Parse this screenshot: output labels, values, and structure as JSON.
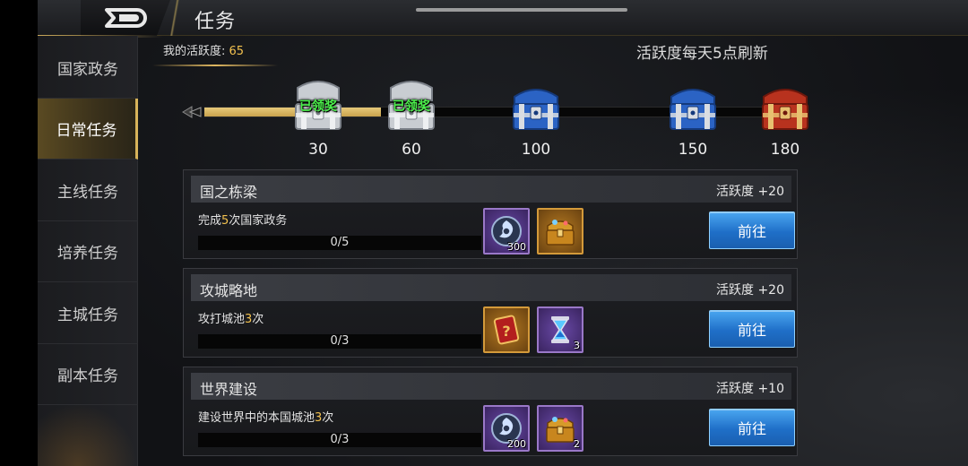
{
  "header": {
    "title": "任务",
    "back_icon": "back-arrow-icon"
  },
  "sidebar": {
    "items": [
      {
        "label": "国家政务",
        "active": false
      },
      {
        "label": "日常任务",
        "active": true
      },
      {
        "label": "主线任务",
        "active": false
      },
      {
        "label": "培养任务",
        "active": false
      },
      {
        "label": "主城任务",
        "active": false
      },
      {
        "label": "副本任务",
        "active": false
      }
    ]
  },
  "activity": {
    "label": "我的活跃度: ",
    "value": "65",
    "refresh_note": "活跃度每天5点刷新",
    "progress_value": 65,
    "progress_max": 180
  },
  "chests": [
    {
      "threshold": "30",
      "type": "silver",
      "claimed": true,
      "claimed_label": "已领奖"
    },
    {
      "threshold": "60",
      "type": "silver",
      "claimed": true,
      "claimed_label": "已领奖"
    },
    {
      "threshold": "100",
      "type": "blue",
      "claimed": false,
      "claimed_label": ""
    },
    {
      "threshold": "150",
      "type": "blue",
      "claimed": false,
      "claimed_label": ""
    },
    {
      "threshold": "180",
      "type": "red",
      "claimed": false,
      "claimed_label": ""
    }
  ],
  "tasks": [
    {
      "title": "国之栋梁",
      "points": "活跃度 +20",
      "desc_pre": "完成",
      "desc_num": "5",
      "desc_post": "次国家政务",
      "progress": "0/5",
      "button": "前往",
      "rewards": [
        {
          "icon": "silver-coin-icon",
          "style": "purple",
          "count": "300"
        },
        {
          "icon": "treasure-chest-icon",
          "style": "orange",
          "count": ""
        }
      ]
    },
    {
      "title": "攻城略地",
      "points": "活跃度 +20",
      "desc_pre": "攻打城池",
      "desc_num": "3",
      "desc_post": "次",
      "progress": "0/3",
      "button": "前往",
      "rewards": [
        {
          "icon": "mystery-card-icon",
          "style": "orange",
          "count": ""
        },
        {
          "icon": "hourglass-icon",
          "style": "purple",
          "count": "3"
        }
      ]
    },
    {
      "title": "世界建设",
      "points": "活跃度 +10",
      "desc_pre": "建设世界中的本国城池",
      "desc_num": "3",
      "desc_post": "次",
      "progress": "0/3",
      "button": "前往",
      "rewards": [
        {
          "icon": "silver-coin-icon",
          "style": "purple",
          "count": "200"
        },
        {
          "icon": "gold-chest-icon",
          "style": "purple",
          "count": "2"
        }
      ]
    }
  ]
}
